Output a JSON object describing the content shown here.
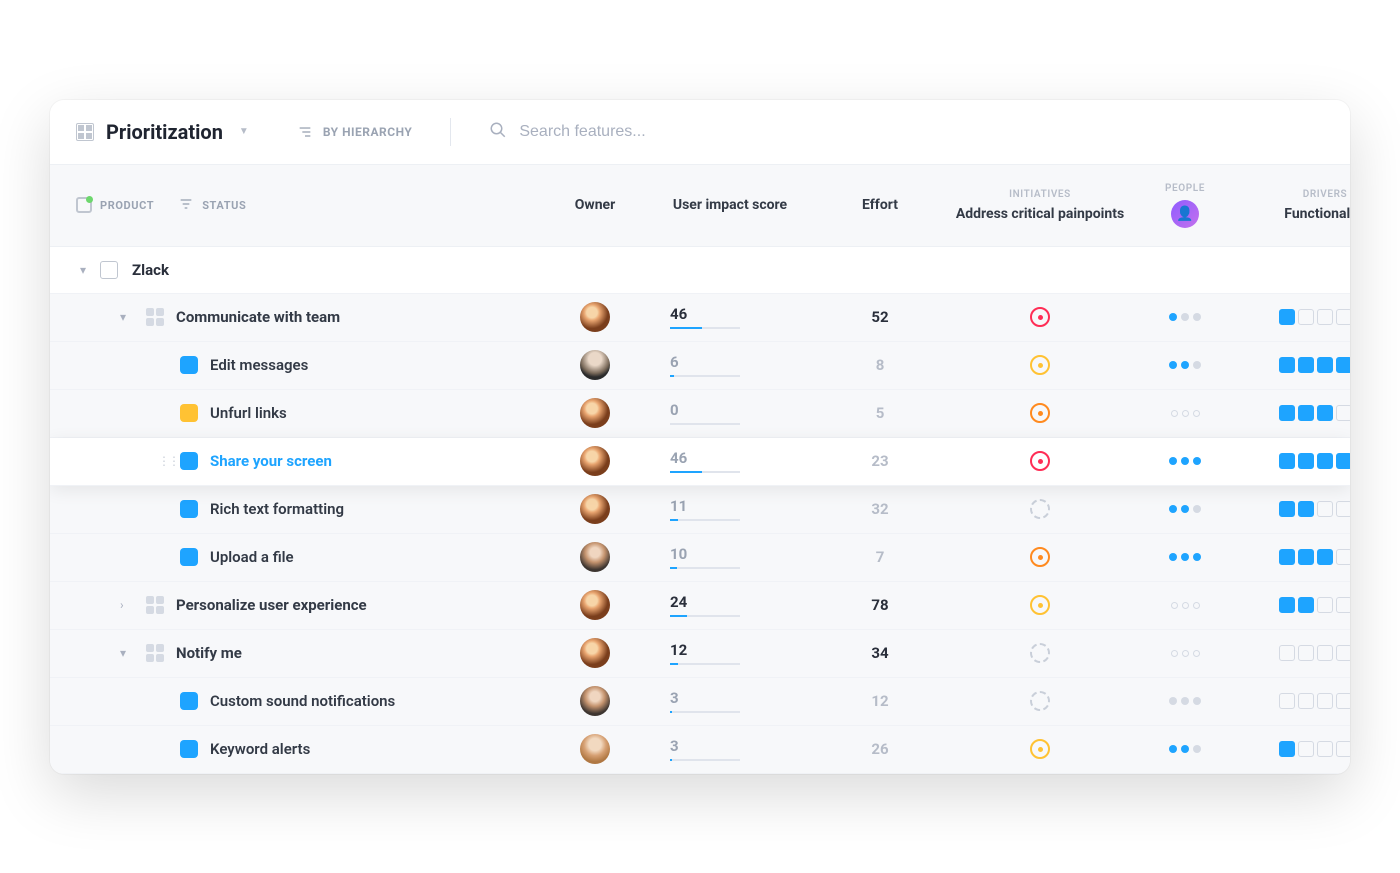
{
  "toolbar": {
    "title": "Prioritization",
    "hierarchy_label": "BY HIERARCHY",
    "search_placeholder": "Search features..."
  },
  "headers": {
    "product": "PRODUCT",
    "status": "STATUS",
    "owner": "Owner",
    "user_impact": "User impact score",
    "effort": "Effort",
    "initiatives_super": "INITIATIVES",
    "initiatives": "Address critical painpoints",
    "people_super": "PEOPLE",
    "drivers_super": "DRIVERS",
    "drivers": "Functionality"
  },
  "group": {
    "name": "Zlack"
  },
  "rows": [
    {
      "level": 1,
      "expanded": true,
      "name": "Communicate with team",
      "owner": "a",
      "score": 46,
      "score_strong": true,
      "score_pct": 46,
      "effort": 52,
      "effort_strong": true,
      "init": "red",
      "people": [
        1,
        0,
        0
      ],
      "drivers": [
        1,
        0,
        0,
        0,
        0
      ]
    },
    {
      "level": 2,
      "name": "Edit messages",
      "color": "blue",
      "owner": "b",
      "score": 6,
      "score_pct": 6,
      "effort": 8,
      "init": "yellow",
      "people": [
        1,
        1,
        0
      ],
      "drivers": [
        1,
        1,
        1,
        1,
        0
      ]
    },
    {
      "level": 2,
      "name": "Unfurl links",
      "color": "yellow",
      "owner": "a",
      "score": 0,
      "score_pct": 0,
      "effort": 5,
      "init": "orange",
      "people_style": "circles",
      "people": [
        0,
        0,
        0
      ],
      "drivers": [
        1,
        1,
        1,
        0,
        0
      ]
    },
    {
      "level": 2,
      "selected": true,
      "handle": true,
      "name": "Share your screen",
      "color": "blue",
      "owner": "a",
      "score": 46,
      "score_pct": 46,
      "effort": 23,
      "init": "red",
      "people": [
        1,
        1,
        1
      ],
      "drivers": [
        1,
        1,
        1,
        1,
        1
      ]
    },
    {
      "level": 2,
      "name": "Rich text formatting",
      "color": "blue",
      "owner": "a",
      "score": 11,
      "score_pct": 11,
      "effort": 32,
      "init": "dashed",
      "people": [
        1,
        1,
        0
      ],
      "drivers": [
        1,
        1,
        0,
        0,
        0
      ]
    },
    {
      "level": 2,
      "name": "Upload a file",
      "color": "blue",
      "owner": "d",
      "score": 10,
      "score_pct": 10,
      "effort": 7,
      "init": "orange",
      "people": [
        1,
        1,
        1
      ],
      "drivers": [
        1,
        1,
        1,
        0,
        0
      ]
    },
    {
      "level": 1,
      "expanded": false,
      "name": "Personalize user experience",
      "owner": "a",
      "score": 24,
      "score_strong": true,
      "score_pct": 24,
      "effort": 78,
      "effort_strong": true,
      "init": "yellow",
      "people_style": "circles",
      "people": [
        0,
        0,
        0
      ],
      "drivers": [
        1,
        1,
        0,
        0,
        0
      ]
    },
    {
      "level": 1,
      "expanded": true,
      "name": "Notify me",
      "owner": "a",
      "score": 12,
      "score_strong": true,
      "score_pct": 12,
      "effort": 34,
      "effort_strong": true,
      "init": "dashed",
      "people_style": "circles",
      "people": [
        0,
        0,
        0
      ],
      "drivers": [
        0,
        0,
        0,
        0,
        0
      ]
    },
    {
      "level": 2,
      "name": "Custom sound notifications",
      "color": "blue",
      "owner": "d",
      "score": 3,
      "score_pct": 3,
      "effort": 12,
      "init": "dashed",
      "people": [
        0,
        0,
        0
      ],
      "drivers": [
        0,
        0,
        0,
        0,
        0
      ]
    },
    {
      "level": 2,
      "name": "Keyword alerts",
      "color": "blue",
      "owner": "e",
      "score": 3,
      "score_pct": 3,
      "effort": 26,
      "init": "yellow",
      "people": [
        1,
        1,
        0
      ],
      "drivers": [
        1,
        0,
        0,
        0,
        0
      ]
    }
  ]
}
